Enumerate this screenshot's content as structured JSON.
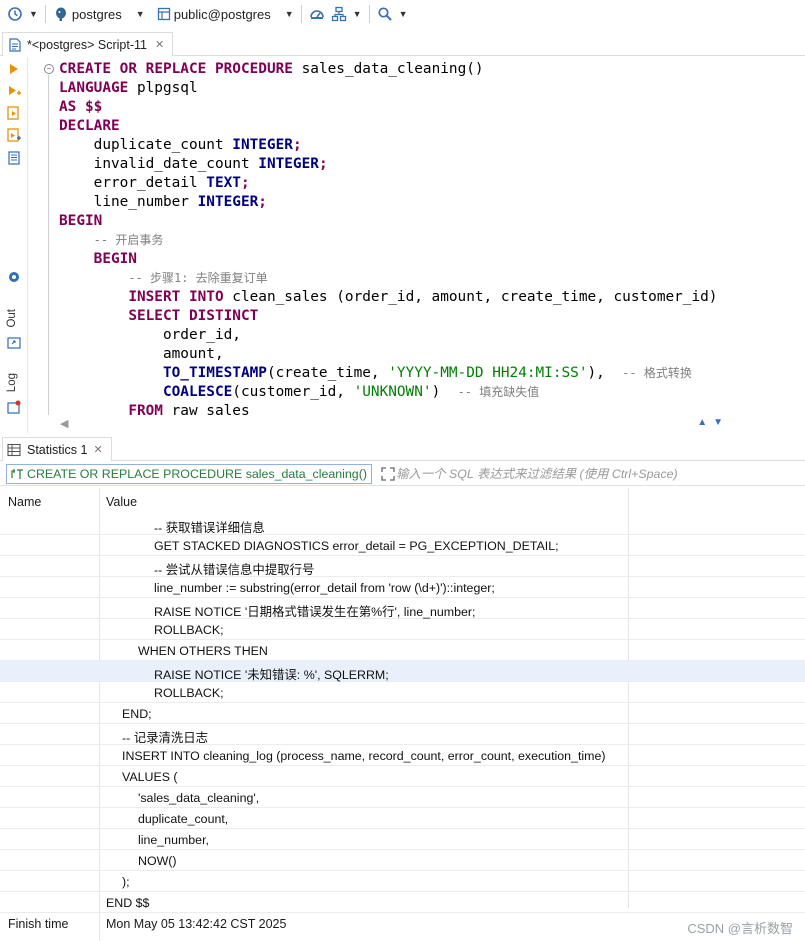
{
  "toolbar": {
    "connection": "postgres",
    "schema": "public@postgres"
  },
  "editor": {
    "tab_title": "*<postgres> Script-11"
  },
  "gutter": {
    "out_label": "Out",
    "log_label": "Log"
  },
  "code_lines": [
    [
      [
        "kw",
        "CREATE"
      ],
      [
        "t",
        " "
      ],
      [
        "kw",
        "OR"
      ],
      [
        "t",
        " "
      ],
      [
        "kw",
        "REPLACE"
      ],
      [
        "t",
        " "
      ],
      [
        "kw",
        "PROCEDURE"
      ],
      [
        "t",
        " sales_data_cleaning()"
      ]
    ],
    [
      [
        "kw",
        "LANGUAGE"
      ],
      [
        "t",
        " plpgsql"
      ]
    ],
    [
      [
        "kw",
        "AS"
      ],
      [
        "t",
        " "
      ],
      [
        "kw",
        "$$"
      ]
    ],
    [
      [
        "kw",
        "DECLARE"
      ]
    ],
    [
      [
        "t",
        "    duplicate_count "
      ],
      [
        "kwb",
        "INTEGER"
      ],
      [
        "kw",
        ";"
      ]
    ],
    [
      [
        "t",
        "    invalid_date_count "
      ],
      [
        "kwb",
        "INTEGER"
      ],
      [
        "kw",
        ";"
      ]
    ],
    [
      [
        "t",
        "    error_detail "
      ],
      [
        "kwb",
        "TEXT"
      ],
      [
        "kw",
        ";"
      ]
    ],
    [
      [
        "t",
        "    line_number "
      ],
      [
        "kwb",
        "INTEGER"
      ],
      [
        "kw",
        ";"
      ]
    ],
    [
      [
        "kw",
        "BEGIN"
      ]
    ],
    [
      [
        "t",
        "    "
      ],
      [
        "cmt",
        "-- 开启事务"
      ]
    ],
    [
      [
        "t",
        "    "
      ],
      [
        "kw",
        "BEGIN"
      ]
    ],
    [
      [
        "t",
        "        "
      ],
      [
        "cmt",
        "-- 步骤1: 去除重复订单"
      ]
    ],
    [
      [
        "t",
        "        "
      ],
      [
        "kw",
        "INSERT"
      ],
      [
        "t",
        " "
      ],
      [
        "kw",
        "INTO"
      ],
      [
        "t",
        " clean_sales (order_id, amount, create_time, customer_id)"
      ]
    ],
    [
      [
        "t",
        "        "
      ],
      [
        "kw",
        "SELECT"
      ],
      [
        "t",
        " "
      ],
      [
        "kw",
        "DISTINCT"
      ]
    ],
    [
      [
        "t",
        "            order_id,"
      ]
    ],
    [
      [
        "t",
        "            amount,"
      ]
    ],
    [
      [
        "t",
        "            "
      ],
      [
        "kwb",
        "TO_TIMESTAMP"
      ],
      [
        "t",
        "(create_time, "
      ],
      [
        "str",
        "'YYYY-MM-DD HH24:MI:SS'"
      ],
      [
        "t",
        "),  "
      ],
      [
        "cmt",
        "-- 格式转换"
      ]
    ],
    [
      [
        "t",
        "            "
      ],
      [
        "kwb",
        "COALESCE"
      ],
      [
        "t",
        "(customer_id, "
      ],
      [
        "str",
        "'UNKNOWN'"
      ],
      [
        "t",
        ")  "
      ],
      [
        "cmt",
        "-- 填充缺失值"
      ]
    ],
    [
      [
        "t",
        "        "
      ],
      [
        "kw",
        "FROM"
      ],
      [
        "t",
        " raw_sales"
      ]
    ]
  ],
  "results": {
    "tab_title": "Statistics 1",
    "query_text": "CREATE OR REPLACE PROCEDURE sales_data_cleaning()",
    "filter_placeholder": "输入一个 SQL 表达式来过滤结果 (使用 Ctrl+Space)",
    "col_name": "Name",
    "col_value": "Value",
    "value_lines": [
      {
        "indent": 3,
        "text": "-- 获取错误详细信息"
      },
      {
        "indent": 3,
        "text": "GET STACKED DIAGNOSTICS error_detail = PG_EXCEPTION_DETAIL;"
      },
      {
        "indent": 3,
        "text": "-- 尝试从错误信息中提取行号"
      },
      {
        "indent": 3,
        "text": "line_number := substring(error_detail from 'row (\\d+)')::integer;"
      },
      {
        "indent": 3,
        "text": "RAISE NOTICE '日期格式错误发生在第%行', line_number;"
      },
      {
        "indent": 3,
        "text": "ROLLBACK;"
      },
      {
        "indent": 2,
        "text": "WHEN OTHERS THEN"
      },
      {
        "indent": 3,
        "text": "RAISE NOTICE '未知错误: %', SQLERRM;",
        "highlight": true
      },
      {
        "indent": 3,
        "text": "ROLLBACK;"
      },
      {
        "indent": 1,
        "text": "END;"
      },
      {
        "indent": 1,
        "text": "-- 记录清洗日志"
      },
      {
        "indent": 1,
        "text": "INSERT INTO cleaning_log (process_name, record_count, error_count, execution_time)"
      },
      {
        "indent": 1,
        "text": "VALUES ("
      },
      {
        "indent": 2,
        "text": "'sales_data_cleaning',"
      },
      {
        "indent": 2,
        "text": "duplicate_count,"
      },
      {
        "indent": 2,
        "text": "line_number,"
      },
      {
        "indent": 2,
        "text": "NOW()"
      },
      {
        "indent": 1,
        "text": ");"
      },
      {
        "indent": 0,
        "text": "END $$"
      }
    ],
    "finish_name": "Finish time",
    "finish_value": "Mon May 05 13:42:42 CST 2025"
  },
  "watermark": "CSDN @言析数智"
}
